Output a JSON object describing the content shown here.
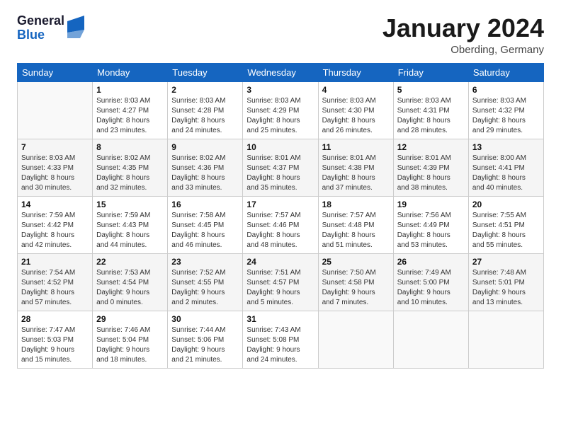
{
  "header": {
    "logo": {
      "line1": "General",
      "line2": "Blue"
    },
    "title": "January 2024",
    "location": "Oberding, Germany"
  },
  "calendar": {
    "days_of_week": [
      "Sunday",
      "Monday",
      "Tuesday",
      "Wednesday",
      "Thursday",
      "Friday",
      "Saturday"
    ],
    "weeks": [
      [
        {
          "day": "",
          "info": ""
        },
        {
          "day": "1",
          "info": "Sunrise: 8:03 AM\nSunset: 4:27 PM\nDaylight: 8 hours\nand 23 minutes."
        },
        {
          "day": "2",
          "info": "Sunrise: 8:03 AM\nSunset: 4:28 PM\nDaylight: 8 hours\nand 24 minutes."
        },
        {
          "day": "3",
          "info": "Sunrise: 8:03 AM\nSunset: 4:29 PM\nDaylight: 8 hours\nand 25 minutes."
        },
        {
          "day": "4",
          "info": "Sunrise: 8:03 AM\nSunset: 4:30 PM\nDaylight: 8 hours\nand 26 minutes."
        },
        {
          "day": "5",
          "info": "Sunrise: 8:03 AM\nSunset: 4:31 PM\nDaylight: 8 hours\nand 28 minutes."
        },
        {
          "day": "6",
          "info": "Sunrise: 8:03 AM\nSunset: 4:32 PM\nDaylight: 8 hours\nand 29 minutes."
        }
      ],
      [
        {
          "day": "7",
          "info": "Sunrise: 8:03 AM\nSunset: 4:33 PM\nDaylight: 8 hours\nand 30 minutes."
        },
        {
          "day": "8",
          "info": "Sunrise: 8:02 AM\nSunset: 4:35 PM\nDaylight: 8 hours\nand 32 minutes."
        },
        {
          "day": "9",
          "info": "Sunrise: 8:02 AM\nSunset: 4:36 PM\nDaylight: 8 hours\nand 33 minutes."
        },
        {
          "day": "10",
          "info": "Sunrise: 8:01 AM\nSunset: 4:37 PM\nDaylight: 8 hours\nand 35 minutes."
        },
        {
          "day": "11",
          "info": "Sunrise: 8:01 AM\nSunset: 4:38 PM\nDaylight: 8 hours\nand 37 minutes."
        },
        {
          "day": "12",
          "info": "Sunrise: 8:01 AM\nSunset: 4:39 PM\nDaylight: 8 hours\nand 38 minutes."
        },
        {
          "day": "13",
          "info": "Sunrise: 8:00 AM\nSunset: 4:41 PM\nDaylight: 8 hours\nand 40 minutes."
        }
      ],
      [
        {
          "day": "14",
          "info": "Sunrise: 7:59 AM\nSunset: 4:42 PM\nDaylight: 8 hours\nand 42 minutes."
        },
        {
          "day": "15",
          "info": "Sunrise: 7:59 AM\nSunset: 4:43 PM\nDaylight: 8 hours\nand 44 minutes."
        },
        {
          "day": "16",
          "info": "Sunrise: 7:58 AM\nSunset: 4:45 PM\nDaylight: 8 hours\nand 46 minutes."
        },
        {
          "day": "17",
          "info": "Sunrise: 7:57 AM\nSunset: 4:46 PM\nDaylight: 8 hours\nand 48 minutes."
        },
        {
          "day": "18",
          "info": "Sunrise: 7:57 AM\nSunset: 4:48 PM\nDaylight: 8 hours\nand 51 minutes."
        },
        {
          "day": "19",
          "info": "Sunrise: 7:56 AM\nSunset: 4:49 PM\nDaylight: 8 hours\nand 53 minutes."
        },
        {
          "day": "20",
          "info": "Sunrise: 7:55 AM\nSunset: 4:51 PM\nDaylight: 8 hours\nand 55 minutes."
        }
      ],
      [
        {
          "day": "21",
          "info": "Sunrise: 7:54 AM\nSunset: 4:52 PM\nDaylight: 8 hours\nand 57 minutes."
        },
        {
          "day": "22",
          "info": "Sunrise: 7:53 AM\nSunset: 4:54 PM\nDaylight: 9 hours\nand 0 minutes."
        },
        {
          "day": "23",
          "info": "Sunrise: 7:52 AM\nSunset: 4:55 PM\nDaylight: 9 hours\nand 2 minutes."
        },
        {
          "day": "24",
          "info": "Sunrise: 7:51 AM\nSunset: 4:57 PM\nDaylight: 9 hours\nand 5 minutes."
        },
        {
          "day": "25",
          "info": "Sunrise: 7:50 AM\nSunset: 4:58 PM\nDaylight: 9 hours\nand 7 minutes."
        },
        {
          "day": "26",
          "info": "Sunrise: 7:49 AM\nSunset: 5:00 PM\nDaylight: 9 hours\nand 10 minutes."
        },
        {
          "day": "27",
          "info": "Sunrise: 7:48 AM\nSunset: 5:01 PM\nDaylight: 9 hours\nand 13 minutes."
        }
      ],
      [
        {
          "day": "28",
          "info": "Sunrise: 7:47 AM\nSunset: 5:03 PM\nDaylight: 9 hours\nand 15 minutes."
        },
        {
          "day": "29",
          "info": "Sunrise: 7:46 AM\nSunset: 5:04 PM\nDaylight: 9 hours\nand 18 minutes."
        },
        {
          "day": "30",
          "info": "Sunrise: 7:44 AM\nSunset: 5:06 PM\nDaylight: 9 hours\nand 21 minutes."
        },
        {
          "day": "31",
          "info": "Sunrise: 7:43 AM\nSunset: 5:08 PM\nDaylight: 9 hours\nand 24 minutes."
        },
        {
          "day": "",
          "info": ""
        },
        {
          "day": "",
          "info": ""
        },
        {
          "day": "",
          "info": ""
        }
      ]
    ]
  }
}
